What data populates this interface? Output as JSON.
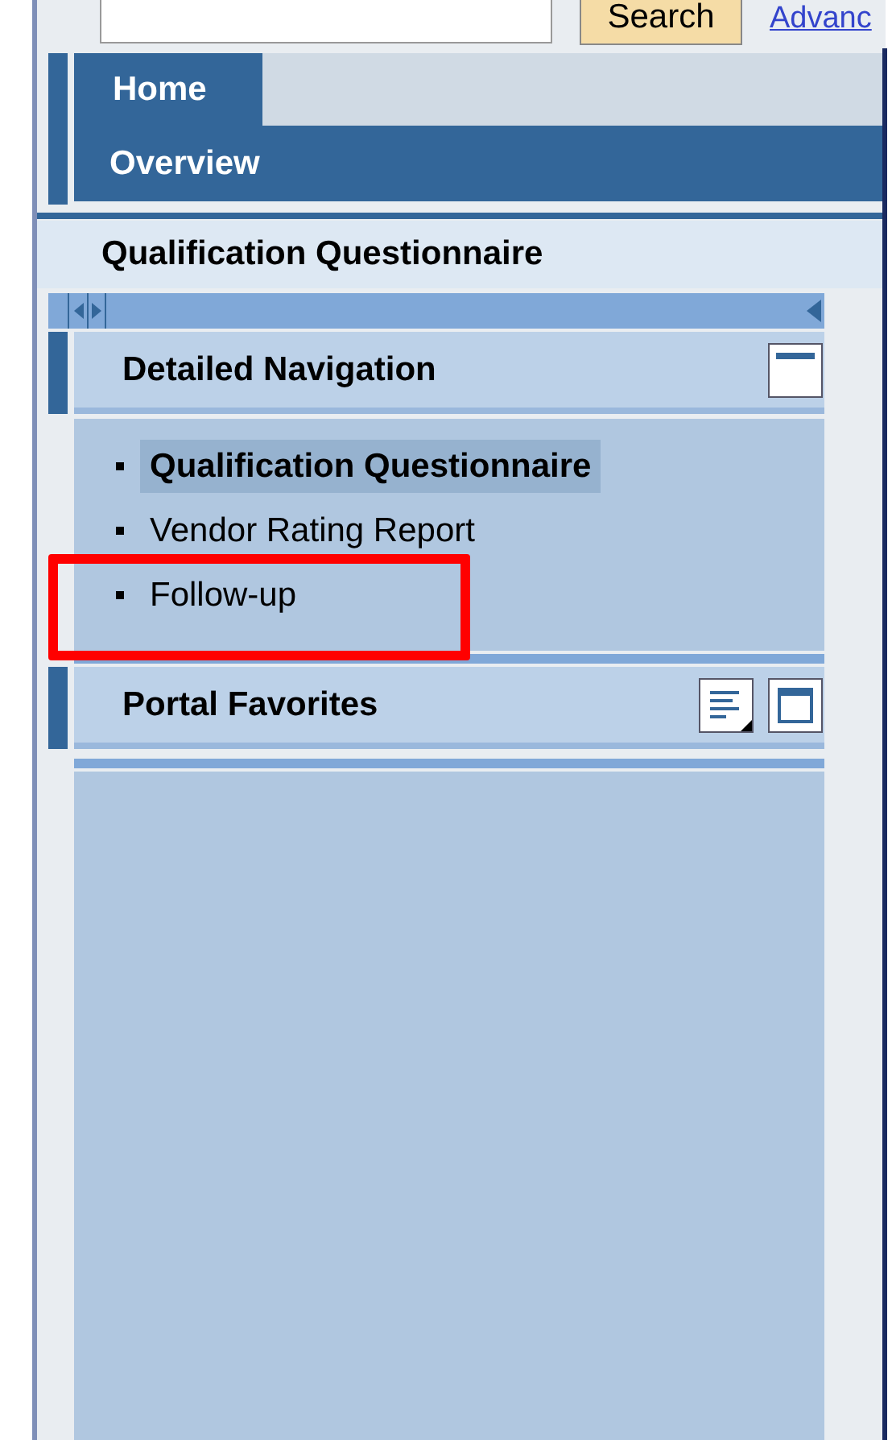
{
  "search": {
    "button": "Search",
    "link": "Advanc"
  },
  "tabs": [
    {
      "label": "Home",
      "selected": true
    }
  ],
  "subnav": {
    "label": "Overview"
  },
  "page_title": "Qualification Questionnaire",
  "detailed_navigation": {
    "title": "Detailed Navigation",
    "items": [
      {
        "label": "Qualification Questionnaire",
        "selected": true,
        "highlighted": false
      },
      {
        "label": "Vendor Rating Report",
        "selected": false,
        "highlighted": false
      },
      {
        "label": "Follow-up",
        "selected": false,
        "highlighted": true
      }
    ]
  },
  "portal_favorites": {
    "title": "Portal Favorites"
  }
}
